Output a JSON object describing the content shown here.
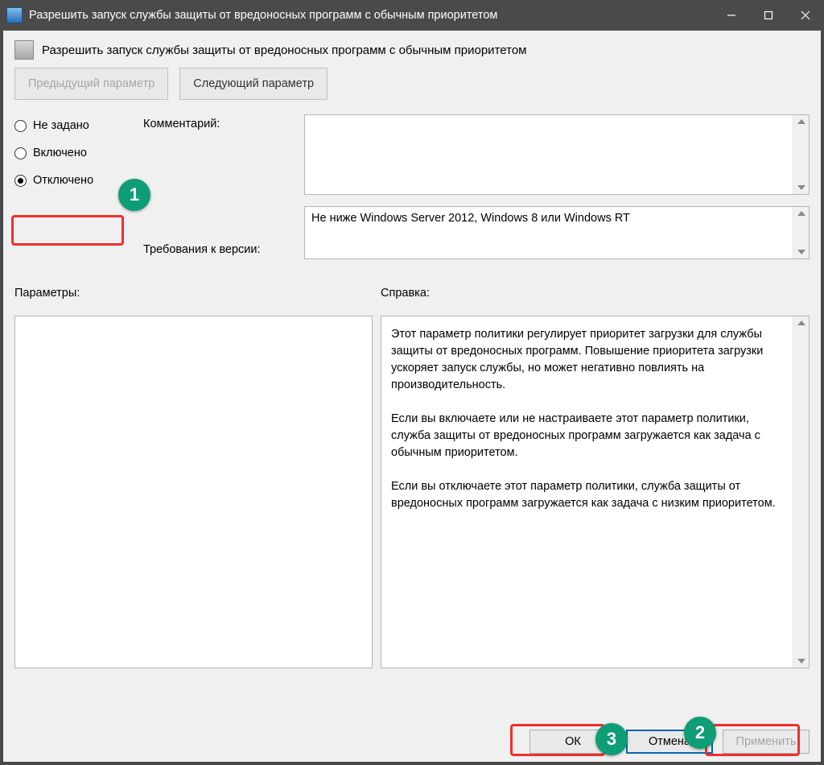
{
  "window": {
    "title": "Разрешить запуск службы защиты от вредоносных программ с обычным приоритетом"
  },
  "header": {
    "title": "Разрешить запуск службы защиты от вредоносных программ с обычным приоритетом"
  },
  "nav": {
    "prev": "Предыдущий параметр",
    "next": "Следующий параметр"
  },
  "state": {
    "not_configured": "Не задано",
    "enabled": "Включено",
    "disabled": "Отключено",
    "selected": "disabled"
  },
  "labels": {
    "comment": "Комментарий:",
    "supported": "Требования к версии:",
    "options": "Параметры:",
    "help": "Справка:"
  },
  "supported_text": "Не ниже Windows Server 2012, Windows 8 или Windows RT",
  "help_text": "Этот параметр политики регулирует приоритет загрузки для службы защиты от вредоносных программ. Повышение приоритета загрузки ускоряет запуск службы, но может негативно повлиять на производительность.\n\nЕсли вы включаете или не настраиваете этот параметр политики, служба защиты от вредоносных программ загружается как задача с обычным приоритетом.\n\nЕсли вы отключаете этот параметр политики, служба защиты от вредоносных программ загружается как задача с низким приоритетом.",
  "buttons": {
    "ok": "ОК",
    "cancel": "Отмена",
    "apply": "Применить"
  },
  "annotations": {
    "b1": "1",
    "b2": "2",
    "b3": "3"
  }
}
